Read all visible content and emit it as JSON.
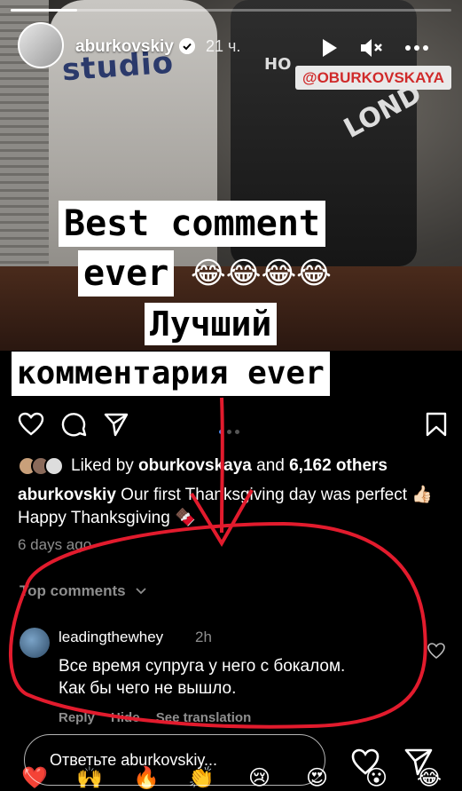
{
  "story": {
    "username": "aburkovskiy",
    "time_ago": "21 ч.",
    "progress": 0.15,
    "mention_tag": "@OBURKOVSKAYA",
    "shirt_text_1": "studio",
    "shirt_text_2": "HO",
    "shirt_text_3": "LOND",
    "caption_lines": [
      "Best comment",
      "ever",
      "Лучший",
      "комментария ever"
    ],
    "caption_emojis": "😂😂😂😂"
  },
  "post": {
    "liked_prefix": "Liked by ",
    "liked_user": "oburkovskaya",
    "liked_and": " and ",
    "liked_others": "6,162 others",
    "author": "aburkovskiy",
    "caption_text": " Our first Thanksgiving day was perfect 👍🏻 Happy Thanksgiving 🍫",
    "time_ago": "6 days ago",
    "top_comments_label": "Top comments"
  },
  "comment": {
    "user": "leadingthewhey",
    "time": "2h",
    "text_line1": "Все время супруга у него с бокалом.",
    "text_line2": "Как бы чего не вышло.",
    "reply_label": "Reply",
    "hide_label": "Hide",
    "see_translation_label": "See translation"
  },
  "reply_bar": {
    "placeholder": "Ответьте aburkovskiy..."
  },
  "quick_reactions": [
    "❤️",
    "🙌",
    "🔥",
    "👏",
    "😢",
    "😍",
    "😮",
    "😂"
  ],
  "colors": {
    "annotation_red": "#e21b2d",
    "tag_text": "#d02a2a",
    "carousel_active": "#4c8df6"
  }
}
